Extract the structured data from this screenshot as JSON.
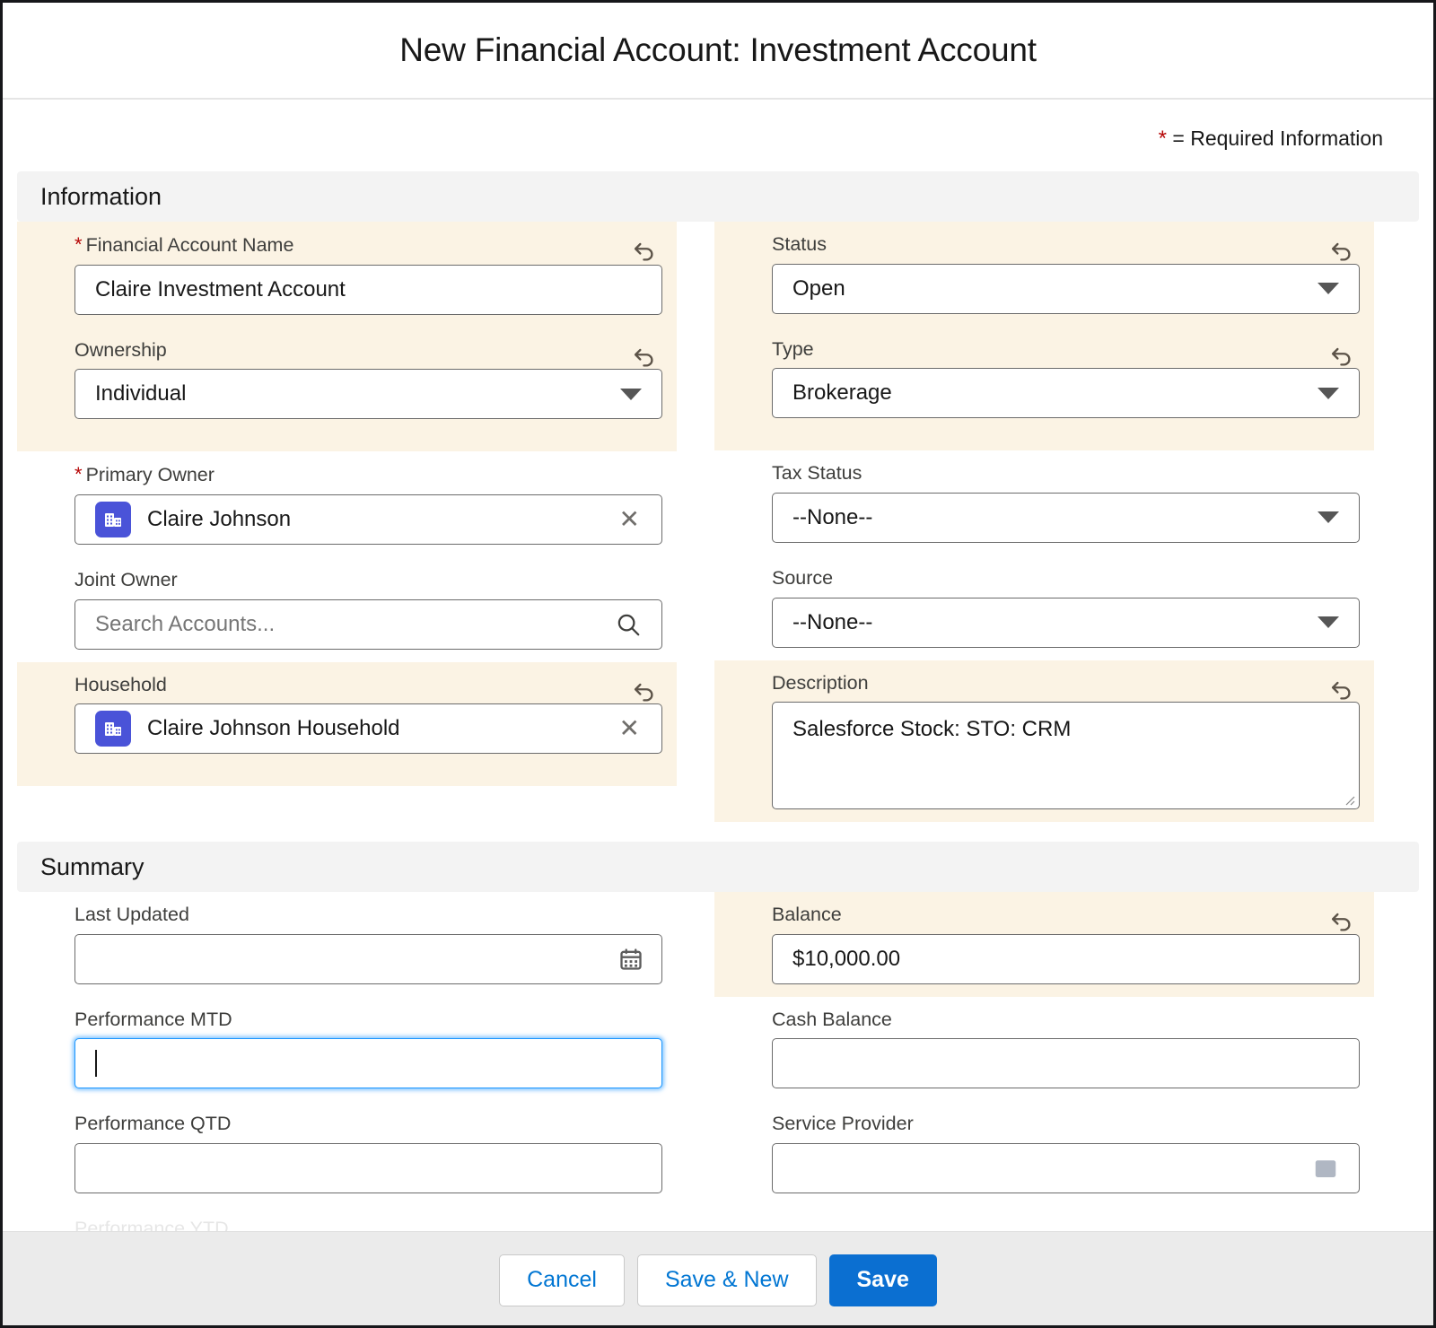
{
  "modal": {
    "title": "New Financial Account: Investment Account",
    "required_note": "= Required Information",
    "required_star": "*"
  },
  "sections": [
    {
      "title": "Information"
    },
    {
      "title": "Summary"
    }
  ],
  "information": {
    "left": {
      "financial_account_name": {
        "label": "Financial Account Name",
        "value": "Claire Investment Account",
        "required_star": "*"
      },
      "ownership": {
        "label": "Ownership",
        "value": "Individual"
      },
      "primary_owner": {
        "label": "Primary Owner",
        "value": "Claire Johnson",
        "required_star": "*"
      },
      "joint_owner": {
        "label": "Joint Owner",
        "placeholder": "Search Accounts..."
      },
      "household": {
        "label": "Household",
        "value": "Claire Johnson Household"
      }
    },
    "right": {
      "status": {
        "label": "Status",
        "value": "Open"
      },
      "type": {
        "label": "Type",
        "value": "Brokerage"
      },
      "tax_status": {
        "label": "Tax Status",
        "value": "--None--"
      },
      "source": {
        "label": "Source",
        "value": "--None--"
      },
      "description": {
        "label": "Description",
        "value": "Salesforce Stock: STO: CRM"
      }
    }
  },
  "summary": {
    "left": {
      "last_updated": {
        "label": "Last Updated",
        "value": ""
      },
      "performance_mtd": {
        "label": "Performance MTD",
        "value": ""
      },
      "performance_qtd": {
        "label": "Performance QTD",
        "value": ""
      },
      "performance_ytd": {
        "label": "Performance YTD",
        "value": ""
      }
    },
    "right": {
      "balance": {
        "label": "Balance",
        "value": "$10,000.00"
      },
      "cash_balance": {
        "label": "Cash Balance",
        "value": ""
      },
      "service_provider": {
        "label": "Service Provider",
        "value": ""
      }
    }
  },
  "footer": {
    "cancel": "Cancel",
    "save_new": "Save & New",
    "save": "Save"
  },
  "colors": {
    "highlight": "#fbf3e4",
    "brand_blue": "#0b6fd1",
    "link_blue": "#0176d3",
    "required_red": "#b60707",
    "focus_blue": "#1b96ff",
    "lookup_icon_blue": "#4a53d8"
  }
}
